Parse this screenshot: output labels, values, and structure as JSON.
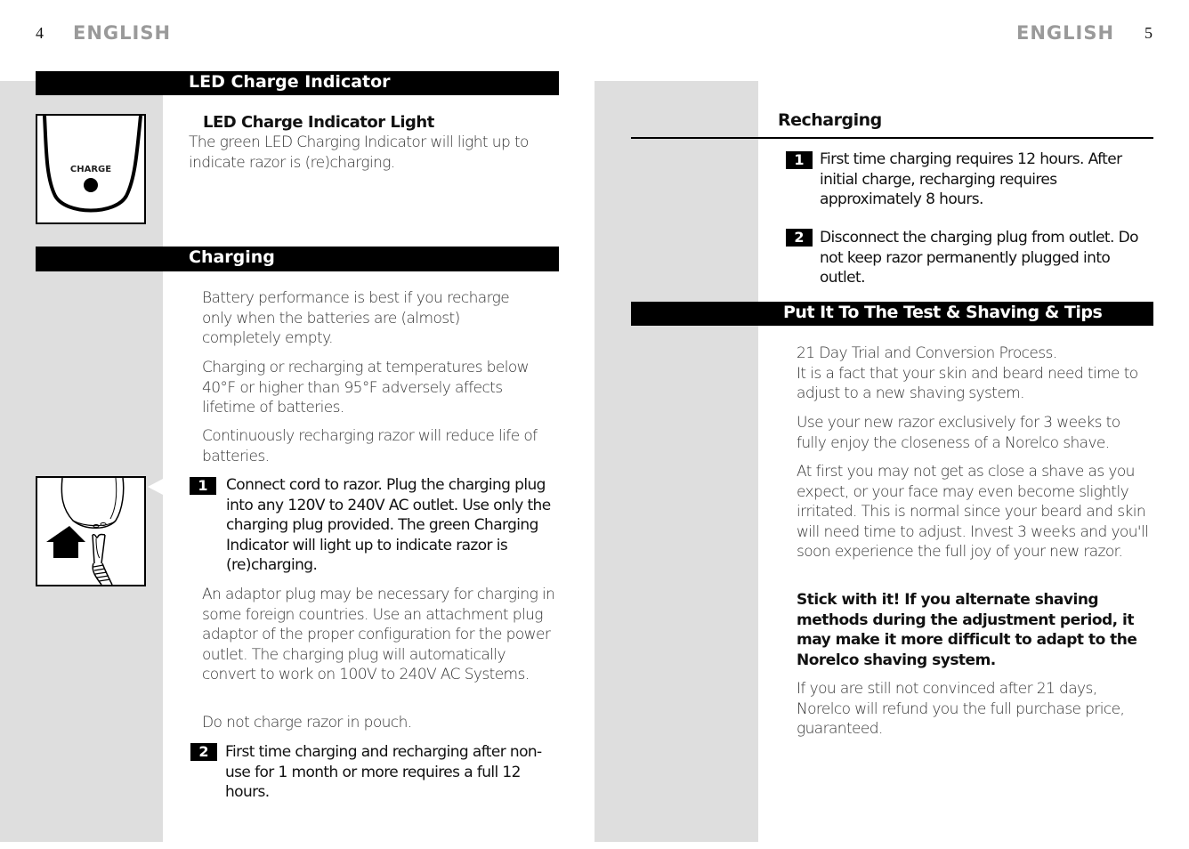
{
  "left_page": {
    "page_number": "4",
    "language": "ENGLISH",
    "sections": {
      "led": {
        "heading": "LED Charge Indicator",
        "subheading": "LED Charge Indicator Light",
        "text": "The green LED Charging Indicator will light up to indicate razor is (re)charging.",
        "illustration_label": "CHARGE"
      },
      "charging": {
        "heading": "Charging",
        "paragraphs": [
          "Battery performance is best if you recharge only when the batteries are (almost) completely empty.",
          "Charging or recharging at temperatures below 40°F or higher than 95°F adversely affects lifetime of batteries.",
          "Continuously recharging razor will reduce life of batteries."
        ],
        "steps": [
          {
            "number": "1",
            "text": "Connect cord to razor. Plug the charging plug into any 120V to 240V AC outlet. Use only the charging plug provided. The green Charging Indicator will light up to indicate razor is (re)charging."
          },
          {
            "number": "2",
            "text": "First time charging and recharging after non-use for 1 month or more requires a full 12 hours."
          }
        ],
        "after_step1": [
          "An adaptor plug may be necessary for charging in some foreign countries. Use an attachment plug adaptor of the proper configuration for the power outlet. The charging plug will automatically convert to work on 100V to 240V AC Systems.",
          "Do not charge razor in pouch."
        ]
      }
    }
  },
  "right_page": {
    "page_number": "5",
    "language": "ENGLISH",
    "sections": {
      "recharging": {
        "heading": "Recharging",
        "steps": [
          {
            "number": "1",
            "text": "First time charging requires 12 hours. After initial charge, recharging requires approximately 8 hours."
          },
          {
            "number": "2",
            "text": "Disconnect the charging plug from outlet. Do not keep razor permanently plugged into outlet."
          }
        ]
      },
      "tips": {
        "heading": "Put It To The Test & Shaving & Tips",
        "paragraphs": [
          "21 Day Trial and Conversion Process.\nIt is a fact that your skin and beard need time to adjust to a new shaving system.",
          "Use your new razor exclusively for 3 weeks to fully enjoy the closeness of a Norelco shave.",
          "At first you may not get as close a shave as you expect, or your face may even become slightly irritated. This is normal since your beard and skin will need time to adjust. Invest 3 weeks and you'll soon experience the full joy of your new razor."
        ],
        "emphasis": "Stick with it! If you alternate shaving methods during the adjustment period, it may make it more difficult to adapt to the Norelco shaving system.",
        "closing": "If you are still not convinced after 21 days, Norelco will refund you the full purchase price, guaranteed."
      }
    }
  }
}
